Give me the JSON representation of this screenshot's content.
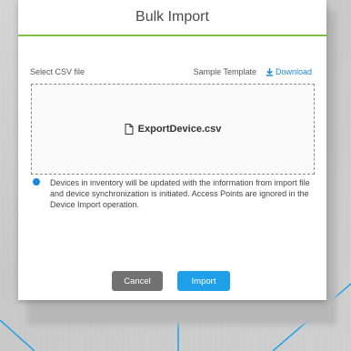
{
  "dialog": {
    "title": "Bulk Import",
    "select_label": "Select CSV file",
    "sample_template_label": "Sample Template",
    "download_label": "Download",
    "file_name": "ExportDevice.csv",
    "info_text": "Devices in inventory will be updated with the information from import file and device synchronization is initiated. Access Points are ignored in the Device Import operation.",
    "cancel_label": "Cancel",
    "import_label": "Import"
  },
  "colors": {
    "accent_rule": "#7fc241",
    "primary_button": "#1e9fe8",
    "secondary_button": "#727272",
    "link": "#1e88d6"
  },
  "icons": {
    "download": "download-icon",
    "file": "file-icon",
    "info": "info-icon"
  }
}
